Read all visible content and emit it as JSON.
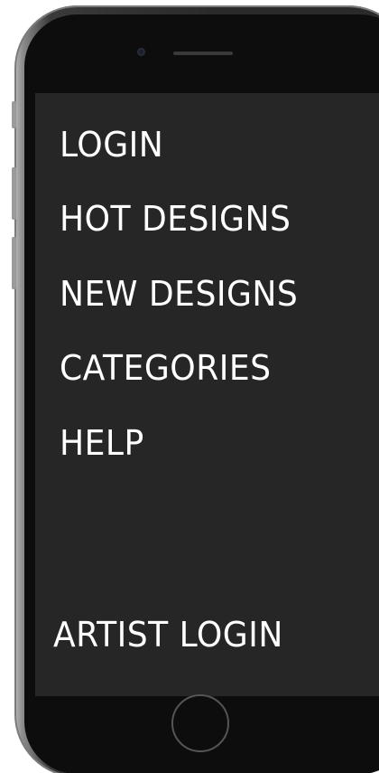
{
  "menu": {
    "items": [
      {
        "label": "LOGIN"
      },
      {
        "label": "HOT DESIGNS"
      },
      {
        "label": "NEW DESIGNS"
      },
      {
        "label": "CATEGORIES"
      },
      {
        "label": "HELP"
      }
    ],
    "artist_login": "ARTIST LOGIN"
  },
  "colors": {
    "screen_background": "#262626",
    "menu_text": "#ffffff",
    "phone_body": "#0d0d0d"
  }
}
